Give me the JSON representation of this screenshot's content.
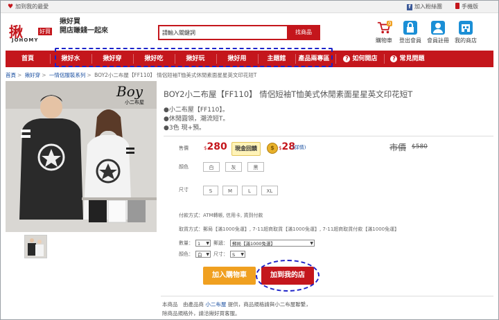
{
  "topbar": {
    "favorite": "加到我的最愛",
    "facebook": "加入粉絲團",
    "mobile": "手機版"
  },
  "header": {
    "logo_big": "揪",
    "logo_small": "好買",
    "logo_en": "JOHOMY",
    "slogan_line1": "揪好買",
    "slogan_line2": "開店賺錢一起來",
    "search_value": "請輸入關鍵詞",
    "search_button": "找商品",
    "icons": [
      {
        "label": "購物車",
        "icon": "cart-icon",
        "badge": "0"
      },
      {
        "label": "登出會員",
        "icon": "lock-icon"
      },
      {
        "label": "會員註冊",
        "icon": "user-icon"
      },
      {
        "label": "我的商店",
        "icon": "shop-icon"
      }
    ]
  },
  "nav": {
    "items": [
      "首頁",
      "揪好水",
      "揪好穿",
      "揪好吃",
      "揪好玩",
      "揪好用",
      "主題館",
      "產品兩專區"
    ],
    "how_to_open": "如何開店",
    "faq": "常見問題"
  },
  "breadcrumb": {
    "items": [
      "首頁",
      "揪好穿",
      "一情侶服裝系列",
      "BOY2小二布屋【FF110】 情侶短袖T恤美式休閒素面星星英文印花短T"
    ]
  },
  "product": {
    "title": "BOY2小二布屋【FF110】 情侶短袖T恤美式休閒素面星星英文印花短T",
    "features": [
      "●小二布屋【FF110】。",
      "●休閒圓領，潮流短T。",
      "●3色 現+預。"
    ],
    "price_label": "售價",
    "currency": "$",
    "price": "280",
    "cashback_label": "現金回饋",
    "cashback_value": "28",
    "detail_link": "(詳情)",
    "market_label": "市價",
    "market_price": "$580",
    "color_label": "顏色",
    "colors": [
      "白",
      "灰",
      "黑"
    ],
    "size_label": "尺寸",
    "sizes": [
      "S",
      "M",
      "L",
      "XL"
    ],
    "payment": "付款方式：ATM轉帳, 信用卡, 貨到付款",
    "pickup": "取貨方式：郵局【滿1000免運】, 7-11超商取貨【滿1000免運】, 7-11超商取貨付款【滿1000免運】",
    "qty_label": "數量：",
    "qty_value": "1",
    "ship_label": "郵遞：",
    "ship_value": "郵局【滿1000免運】",
    "color2_label": "顏色：",
    "color2_value": "白",
    "size2_label": "尺寸：",
    "size2_value": "S",
    "add_cart": "加入購物車",
    "add_shop": "加到我的店",
    "footnote_line1_a": "本商品　由產品商",
    "footnote_shop": "小二布屋",
    "footnote_line1_b": "提供，商品規格請與小二布屋聯繫，",
    "footnote_line2": "除商品規格外，請洽揪好買客服。",
    "brand_mark": "Boy",
    "brand_sub": "小二布屋"
  },
  "colors": {
    "brand_red": "#c4161c",
    "cart_orange": "#f0a020",
    "annotation_blue": "#1d23c8"
  }
}
